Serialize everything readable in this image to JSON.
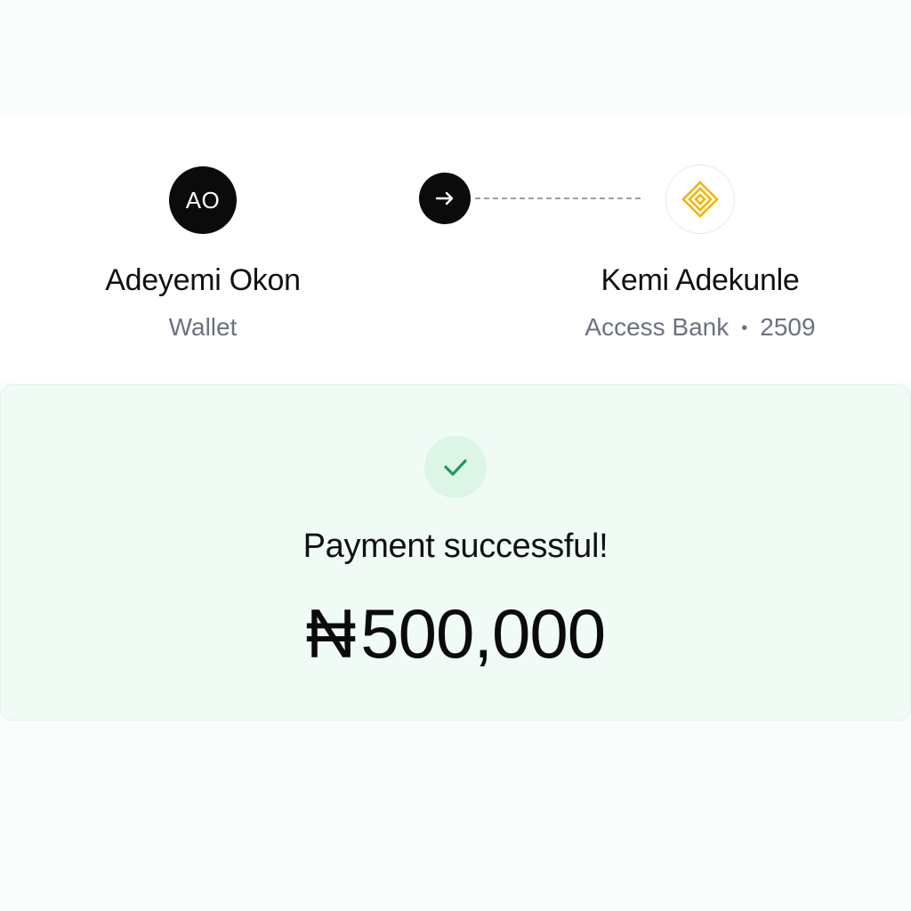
{
  "sender": {
    "initials": "AO",
    "name": "Adeyemi Okon",
    "account_type": "Wallet"
  },
  "transfer": {
    "icon": "arrow-right-icon"
  },
  "recipient": {
    "logo_icon": "access-bank-diamond-icon",
    "name": "Kemi Adekunle",
    "bank": "Access Bank",
    "separator": "•",
    "account_suffix": "2509"
  },
  "status": {
    "icon": "checkmark-icon",
    "message": "Payment successful!",
    "currency_symbol": "₦",
    "amount": "500,000"
  },
  "colors": {
    "success_bg": "#f1fbf6",
    "success_check": "#1e9a5e",
    "bank_logo": "#f5b400",
    "dark": "#0b0b0b"
  }
}
